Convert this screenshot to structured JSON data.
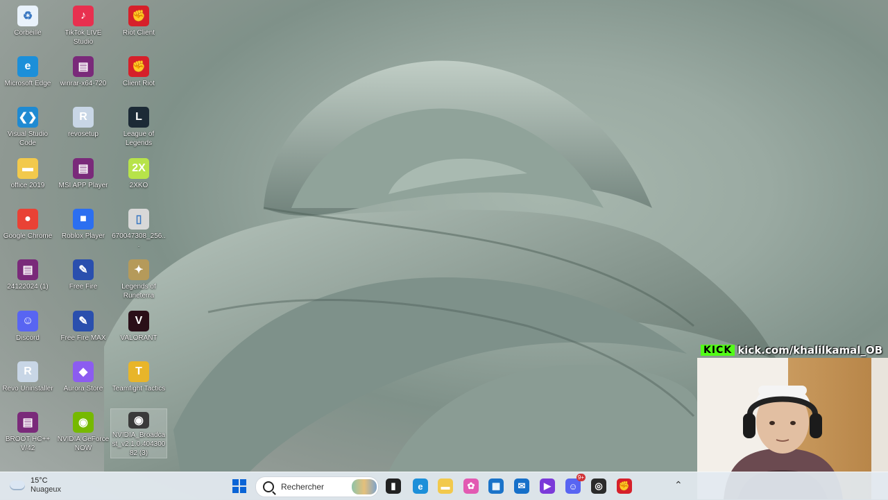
{
  "desktop_icons": [
    {
      "label": "Corbeille",
      "icon": "recycle-bin-icon",
      "color": "#e9f2fb"
    },
    {
      "label": "TikTok LIVE Studio",
      "icon": "tiktok-icon",
      "color": "#e8304f"
    },
    {
      "label": "Riot Client",
      "icon": "riot-icon",
      "color": "#d6202a"
    },
    {
      "label": "Microsoft Edge",
      "icon": "edge-icon",
      "color": "#1c8fd9"
    },
    {
      "label": "winrar-x64-720",
      "icon": "winrar-icon",
      "color": "#7a2a7a"
    },
    {
      "label": "Client Riot",
      "icon": "riot-icon",
      "color": "#d6202a"
    },
    {
      "label": "Visual Studio Code",
      "icon": "vscode-icon",
      "color": "#1f8ad2"
    },
    {
      "label": "revosetup",
      "icon": "revo-icon",
      "color": "#c8d6e6"
    },
    {
      "label": "League of Legends",
      "icon": "league-icon",
      "color": "#1c2a36"
    },
    {
      "label": "office 2019",
      "icon": "folder-icon",
      "color": "#f2c94c"
    },
    {
      "label": "MSI APP Player",
      "icon": "winrar-icon",
      "color": "#7a2a7a"
    },
    {
      "label": "2XKO",
      "icon": "2xko-icon",
      "color": "#b7e34a"
    },
    {
      "label": "Google Chrome",
      "icon": "chrome-icon",
      "color": "#e94235"
    },
    {
      "label": "Roblox Player",
      "icon": "roblox-icon",
      "color": "#2c6ff0"
    },
    {
      "label": "670047308_256...",
      "icon": "file-icon",
      "color": "#d8d8d8"
    },
    {
      "label": "24122024 (1)",
      "icon": "winrar-icon",
      "color": "#7a2a7a"
    },
    {
      "label": "Free Fire",
      "icon": "freefire-icon",
      "color": "#2a4fae"
    },
    {
      "label": "Legends of Runeterra",
      "icon": "runeterra-icon",
      "color": "#b59a5a"
    },
    {
      "label": "Discord",
      "icon": "discord-icon",
      "color": "#5865f2"
    },
    {
      "label": "Free Fire MAX",
      "icon": "freefire-icon",
      "color": "#2a4fae"
    },
    {
      "label": "VALORANT",
      "icon": "valorant-icon",
      "color": "#2a0f18"
    },
    {
      "label": "Revo Uninstaller",
      "icon": "revo-icon",
      "color": "#c8d6e6"
    },
    {
      "label": "Aurora Store",
      "icon": "aurora-icon",
      "color": "#8c5cf0"
    },
    {
      "label": "Teamfight Tactics",
      "icon": "tft-icon",
      "color": "#e8b52a"
    },
    {
      "label": "BROOT HC++ V/42",
      "icon": "winrar-icon",
      "color": "#7a2a7a"
    },
    {
      "label": "NVIDIA GeForce NOW",
      "icon": "nvidia-icon",
      "color": "#76b900"
    },
    {
      "label": "NVIDIA_Broadcast_v2.1.0.40430082 (3)",
      "icon": "nvidia-icon",
      "color": "#3a3a3a",
      "selected": true
    }
  ],
  "taskbar": {
    "weather": {
      "temp": "15°C",
      "condition": "Nuageux",
      "icon": "cloud-icon"
    },
    "search_placeholder": "Rechercher",
    "apps": [
      {
        "name": "start-button",
        "icon": "windows-logo-icon",
        "color": "#0a64d6"
      },
      {
        "name": "task-view",
        "icon": "task-view-icon",
        "color": "#222222"
      },
      {
        "name": "edge",
        "icon": "edge-icon",
        "color": "#1c8fd9"
      },
      {
        "name": "file-explorer",
        "icon": "folder-icon",
        "color": "#f2c94c"
      },
      {
        "name": "copilot",
        "icon": "copilot-icon",
        "color": "#e25ab2"
      },
      {
        "name": "ms-store",
        "icon": "store-icon",
        "color": "#1a73c9"
      },
      {
        "name": "outlook",
        "icon": "outlook-icon",
        "color": "#1670c9"
      },
      {
        "name": "clipchamp",
        "icon": "clipchamp-icon",
        "color": "#7b3ad9"
      },
      {
        "name": "discord",
        "icon": "discord-icon",
        "color": "#5865f2",
        "badge": "9+"
      },
      {
        "name": "obs",
        "icon": "obs-icon",
        "color": "#2b2b2b"
      },
      {
        "name": "riot",
        "icon": "riot-icon",
        "color": "#d6202a"
      }
    ]
  },
  "stream_overlay": {
    "kick_logo": "KICK",
    "url": "kick.com/khalilkamal_OB",
    "accent": "#53fc18"
  }
}
